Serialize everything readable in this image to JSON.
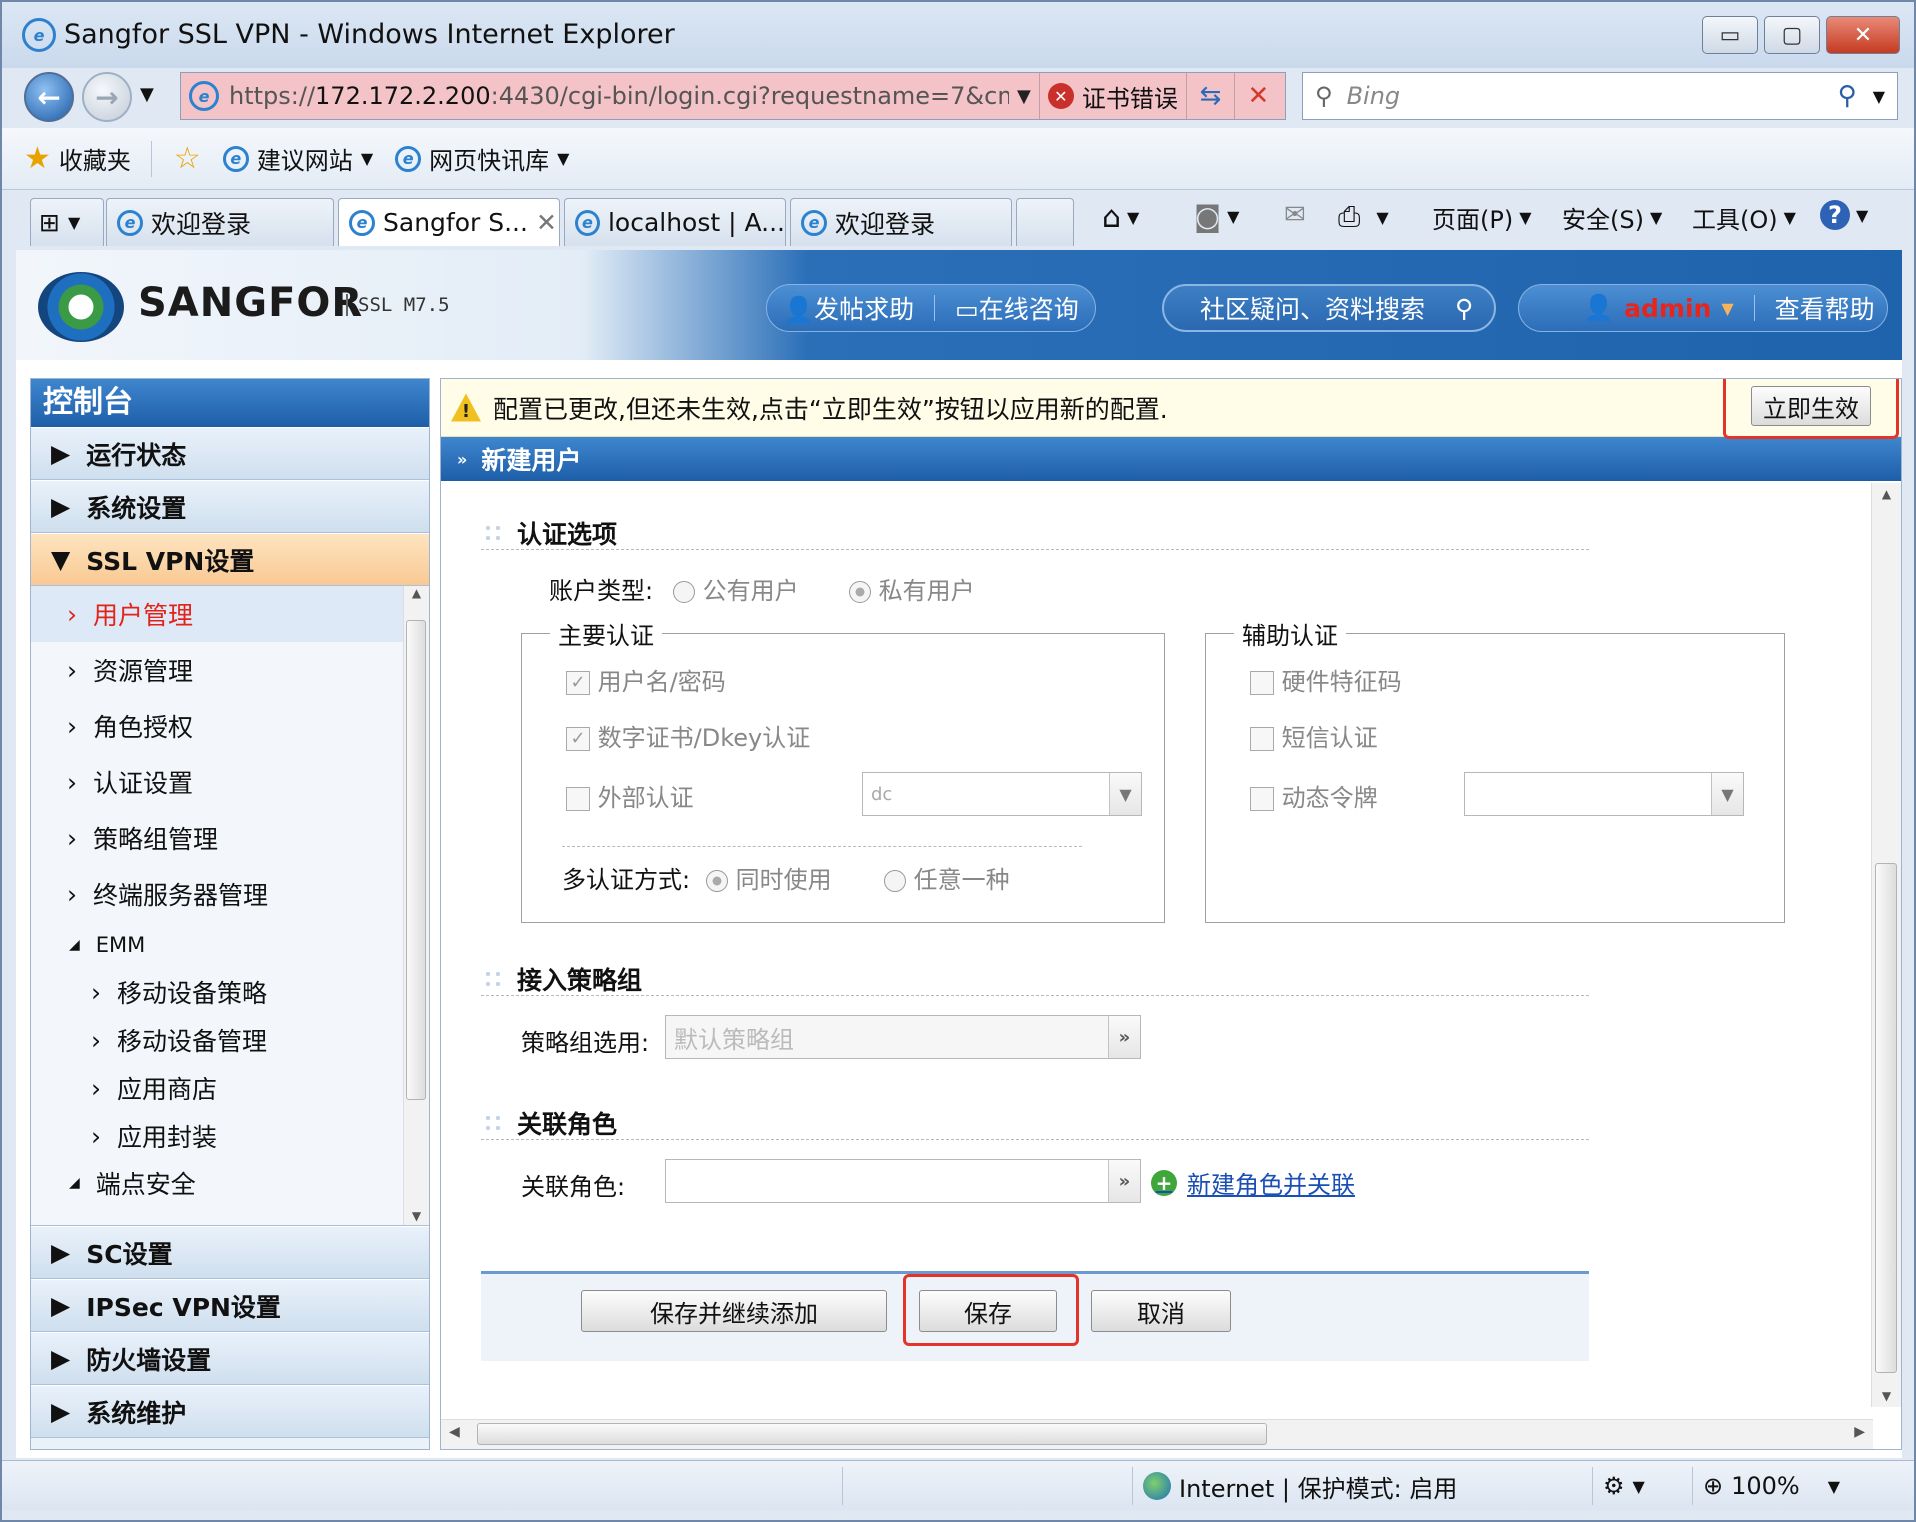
{
  "window": {
    "title": "Sangfor SSL VPN - Windows Internet Explorer",
    "minimize": "▭",
    "maximize": "▢",
    "close": "✕"
  },
  "addressbar": {
    "url_prefix": "https://",
    "url_host": "172.172.2.200",
    "url_rest": ":4430/cgi-bin/login.cgi?requestname=7&cm",
    "cert_error": "证书错误",
    "search_placeholder": "Bing"
  },
  "favorites": {
    "favorites_label": "收藏夹",
    "suggested_sites": "建议网站",
    "web_slice": "网页快讯库"
  },
  "tabs": [
    {
      "label": "欢迎登录"
    },
    {
      "label": "Sangfor S..."
    },
    {
      "label": "localhost | A..."
    },
    {
      "label": "欢迎登录"
    }
  ],
  "command_bar": {
    "page": "页面(P)",
    "safety": "安全(S)",
    "tools": "工具(O)"
  },
  "header": {
    "brand": "SANGFOR",
    "product": "SSL M7.5",
    "post_help": "发帖求助",
    "online_consult": "在线咨询",
    "community_search": "社区疑问、资料搜索",
    "user": "admin",
    "view_help": "查看帮助"
  },
  "sidebar": {
    "title": "控制台",
    "sections_top": [
      {
        "label": "运行状态"
      },
      {
        "label": "系统设置"
      }
    ],
    "open_section": "SSL VPN设置",
    "items": [
      {
        "label": "用户管理"
      },
      {
        "label": "资源管理"
      },
      {
        "label": "角色授权"
      },
      {
        "label": "认证设置"
      },
      {
        "label": "策略组管理"
      },
      {
        "label": "终端服务器管理"
      }
    ],
    "group_emm": "EMM",
    "emm_items": [
      {
        "label": "移动设备策略"
      },
      {
        "label": "移动设备管理"
      },
      {
        "label": "应用商店"
      },
      {
        "label": "应用封装"
      }
    ],
    "group_endpoint": "端点安全",
    "sections_bottom": [
      {
        "label": "SC设置"
      },
      {
        "label": "IPSec VPN设置"
      },
      {
        "label": "防火墙设置"
      },
      {
        "label": "系统维护"
      }
    ]
  },
  "notice": {
    "text": "配置已更改,但还未生效,点击“立即生效”按钮以应用新的配置.",
    "apply_button": "立即生效"
  },
  "panel": {
    "title": "新建用户"
  },
  "auth_options": {
    "title": "认证选项",
    "account_type_label": "账户类型:",
    "public_user": "公有用户",
    "private_user": "私有用户",
    "primary": {
      "legend": "主要认证",
      "username_password": "用户名/密码",
      "digital_cert": "数字证书/Dkey认证",
      "external_auth": "外部认证",
      "external_value": "dc",
      "multi_auth_label": "多认证方式:",
      "use_all": "同时使用",
      "any_one": "任意一种"
    },
    "secondary": {
      "legend": "辅助认证",
      "hardware_id": "硬件特征码",
      "sms_auth": "短信认证",
      "dynamic_token": "动态令牌"
    }
  },
  "policy_group": {
    "title": "接入策略组",
    "label": "策略组选用:",
    "value": "默认策略组"
  },
  "role": {
    "title": "关联角色",
    "label": "关联角色:",
    "new_role_link": "新建角色并关联"
  },
  "buttons": {
    "save_continue": "保存并继续添加",
    "save": "保存",
    "cancel": "取消"
  },
  "statusbar": {
    "zone": "Internet | 保护模式: 启用",
    "zoom": "100%"
  },
  "colors": {
    "accent_blue": "#1e5ea8",
    "highlight_red": "#e3342a",
    "selected_text": "#e2231a"
  }
}
